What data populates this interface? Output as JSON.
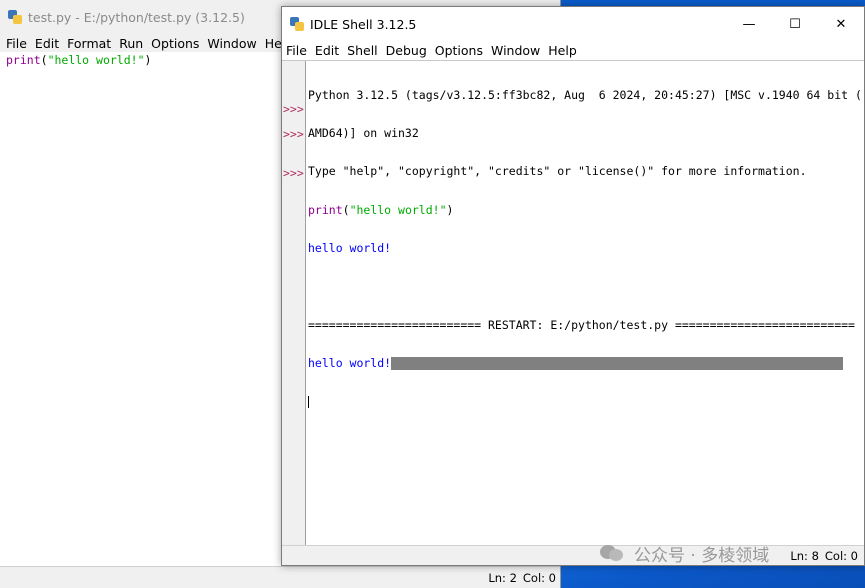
{
  "editor": {
    "title": "test.py - E:/python/test.py (3.12.5)",
    "menu": [
      "File",
      "Edit",
      "Format",
      "Run",
      "Options",
      "Window",
      "Help"
    ],
    "code": {
      "kw": "print",
      "open": "(",
      "str": "\"hello world!\"",
      "close": ")"
    },
    "status": {
      "ln": "Ln: 2",
      "col": "Col: 0"
    }
  },
  "shell": {
    "title": "IDLE Shell 3.12.5",
    "controls": {
      "minimize": "—",
      "maximize": "☐",
      "close": "✕"
    },
    "menu": [
      "File",
      "Edit",
      "Shell",
      "Debug",
      "Options",
      "Window",
      "Help"
    ],
    "lines": {
      "banner1": "Python 3.12.5 (tags/v3.12.5:ff3bc82, Aug  6 2024, 20:45:27) [MSC v.1940 64 bit (",
      "banner2": "AMD64)] on win32",
      "banner3": "Type \"help\", \"copyright\", \"credits\" or \"license()\" for more information.",
      "cmd_kw": "print",
      "cmd_open": "(",
      "cmd_str": "\"hello world!\"",
      "cmd_close": ")",
      "out1": "hello world!",
      "restart": "========================= RESTART: E:/python/test.py ==========================",
      "out2": "hello world!"
    },
    "prompt": ">>>",
    "status": {
      "ln": "Ln: 8",
      "col": "Col: 0"
    }
  },
  "watermark": "公众号 · 多棱领域",
  "colors": {
    "keyword": "#900090",
    "string": "#00aa00",
    "output": "#0000ff",
    "prompt": "#b03060"
  }
}
